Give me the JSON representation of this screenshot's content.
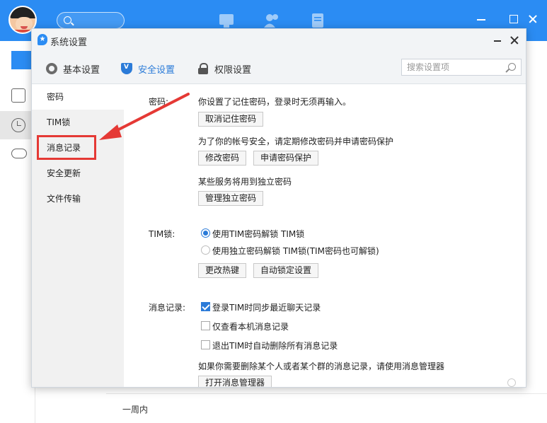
{
  "main_window": {
    "bottom_label": "一周内",
    "icons": [
      "search-icon",
      "message-icon",
      "contacts-icon",
      "document-icon",
      "minimize-icon",
      "maximize-icon",
      "close-icon"
    ]
  },
  "dialog": {
    "title": "系统设置",
    "tabs": [
      {
        "label": "基本设置",
        "icon": "gear-icon"
      },
      {
        "label": "安全设置",
        "icon": "shield-icon",
        "active": true
      },
      {
        "label": "权限设置",
        "icon": "lock-icon"
      }
    ],
    "search": {
      "placeholder": "搜索设置项",
      "value": ""
    },
    "sidebar": {
      "items": [
        {
          "label": "密码",
          "active": true
        },
        {
          "label": "TIM锁"
        },
        {
          "label": "消息记录",
          "highlighted": true
        },
        {
          "label": "安全更新"
        },
        {
          "label": "文件传输"
        }
      ]
    },
    "password": {
      "label": "密码:",
      "remembered_text": "你设置了记住密码，登录时无须再输入。",
      "cancel_remember_btn": "取消记住密码",
      "protect_text": "为了你的帐号安全，请定期修改密码并申请密码保护",
      "change_btn": "修改密码",
      "apply_protect_btn": "申请密码保护",
      "independent_text": "某些服务将用到独立密码",
      "manage_independent_btn": "管理独立密码"
    },
    "tim_lock": {
      "label": "TIM锁:",
      "options": [
        {
          "label": "使用TIM密码解锁 TIM锁",
          "selected": true
        },
        {
          "label": "使用独立密码解锁 TIM锁(TIM密码也可解锁)",
          "selected": false
        }
      ],
      "hotkey_btn": "更改热键",
      "auto_lock_btn": "自动锁定设置"
    },
    "message_record": {
      "label": "消息记录:",
      "options": [
        {
          "label": "登录TIM时同步最近聊天记录",
          "checked": true
        },
        {
          "label": "仅查看本机消息记录",
          "checked": false
        },
        {
          "label": "退出TIM时自动删除所有消息记录",
          "checked": false
        }
      ],
      "manager_text": "如果你需要删除某个人或者某个群的消息记录，请使用消息管理器",
      "open_manager_btn": "打开消息管理器"
    },
    "colors": {
      "accent": "#2b7bd8",
      "title_blue": "#2b8cf3",
      "highlight_red": "#e53935"
    }
  }
}
